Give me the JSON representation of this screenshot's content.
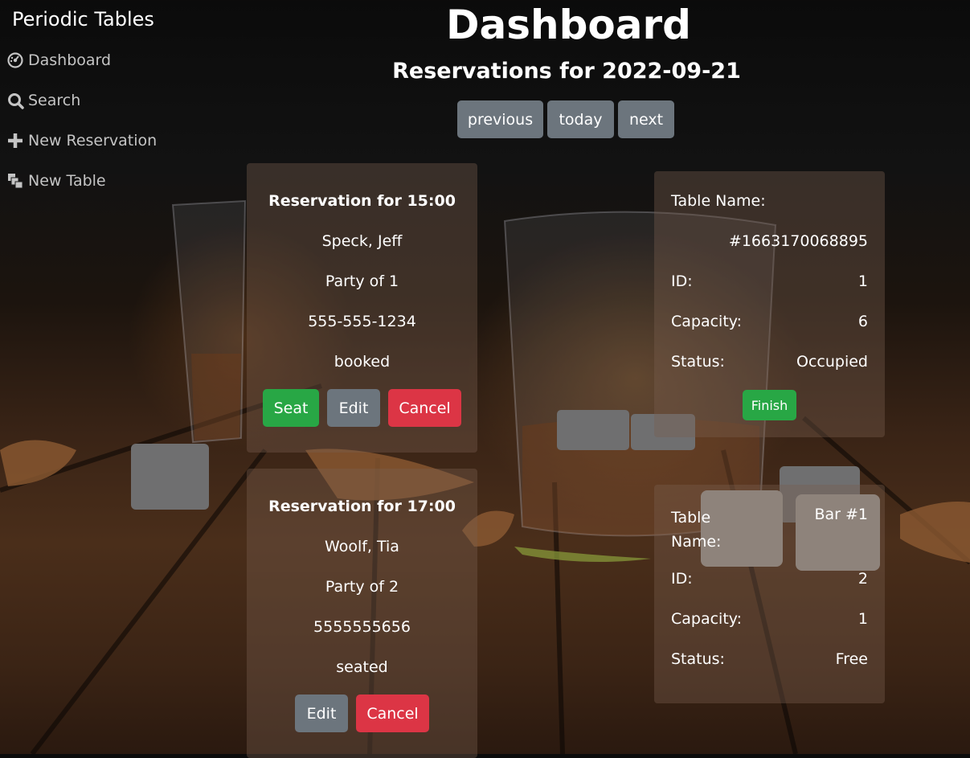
{
  "sidebar": {
    "brand": "Periodic Tables",
    "items": [
      {
        "label": "Dashboard",
        "icon": "dashboard-icon"
      },
      {
        "label": "Search",
        "icon": "search-icon"
      },
      {
        "label": "New Reservation",
        "icon": "plus-icon"
      },
      {
        "label": "New Table",
        "icon": "layers-icon"
      }
    ]
  },
  "header": {
    "title": "Dashboard",
    "subtitle": "Reservations for 2022-09-21",
    "nav": {
      "previous": "previous",
      "today": "today",
      "next": "next"
    }
  },
  "reservations": [
    {
      "heading": "Reservation for 15:00",
      "name": "Speck, Jeff",
      "party": "Party of 1",
      "phone": "555-555-1234",
      "status": "booked",
      "actions": {
        "seat": "Seat",
        "edit": "Edit",
        "cancel": "Cancel"
      }
    },
    {
      "heading": "Reservation for 17:00",
      "name": "Woolf, Tia",
      "party": "Party of 2",
      "phone": "5555555656",
      "status": "seated",
      "actions": {
        "edit": "Edit",
        "cancel": "Cancel"
      }
    }
  ],
  "tables": [
    {
      "name_label": "Table Name:",
      "name": "#1663170068895",
      "id_label": "ID:",
      "id": "1",
      "capacity_label": "Capacity:",
      "capacity": "6",
      "status_label": "Status:",
      "status": "Occupied",
      "finish": "Finish"
    },
    {
      "name_label_1": "Table",
      "name_label_2": "Name:",
      "name": "Bar #1",
      "id_label": "ID:",
      "id": "2",
      "capacity_label": "Capacity:",
      "capacity": "1",
      "status_label": "Status:",
      "status": "Free"
    }
  ],
  "colors": {
    "grey_button": "#6c757d",
    "green_button": "#28a745",
    "red_button": "#dc3545"
  }
}
